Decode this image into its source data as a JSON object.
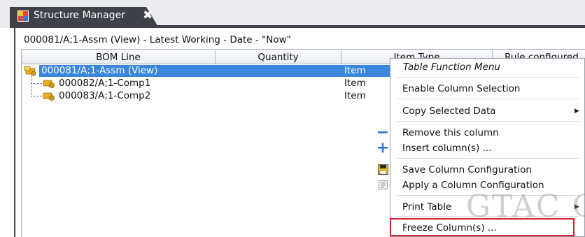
{
  "window": {
    "tab_title": "Structure Manager",
    "close_glyph": "✖"
  },
  "context_line": "000081/A;1-Assm (View) - Latest Working - Date - \"Now\"",
  "table": {
    "columns": [
      "BOM Line",
      "Quantity",
      "Item Type",
      "Rule configured"
    ],
    "rows": [
      {
        "bom_line": "000081/A;1-Assm (View)",
        "quantity": "",
        "item_type": "Item",
        "selected": true
      },
      {
        "bom_line": "000082/A;1-Comp1",
        "quantity": "",
        "item_type": "Item",
        "selected": false
      },
      {
        "bom_line": "000083/A;1-Comp2",
        "quantity": "",
        "item_type": "Item",
        "selected": false
      }
    ]
  },
  "menu": {
    "title": "Table Function Menu",
    "items": [
      {
        "label": "Enable Column Selection",
        "icon": ""
      },
      {
        "label": "Copy Selected Data",
        "icon": "",
        "submenu": true
      },
      {
        "label": "Remove this column",
        "icon": "minus-icon"
      },
      {
        "label": "Insert column(s) ...",
        "icon": "plus-icon"
      },
      {
        "label": "Save Column Configuration",
        "icon": "save-icon"
      },
      {
        "label": "Apply a Column Configuration",
        "icon": "apply-config-icon"
      },
      {
        "label": "Print Table",
        "icon": "",
        "submenu": true
      },
      {
        "label": "Freeze Column(s) ...",
        "icon": "",
        "highlighted": true
      }
    ]
  },
  "watermark": "GTAC Gr",
  "colors": {
    "tab_dark": "#3f4148",
    "selection_blue": "#3a86db",
    "highlight_red": "#d2232a",
    "icon_blue": "#2a6fd6"
  }
}
